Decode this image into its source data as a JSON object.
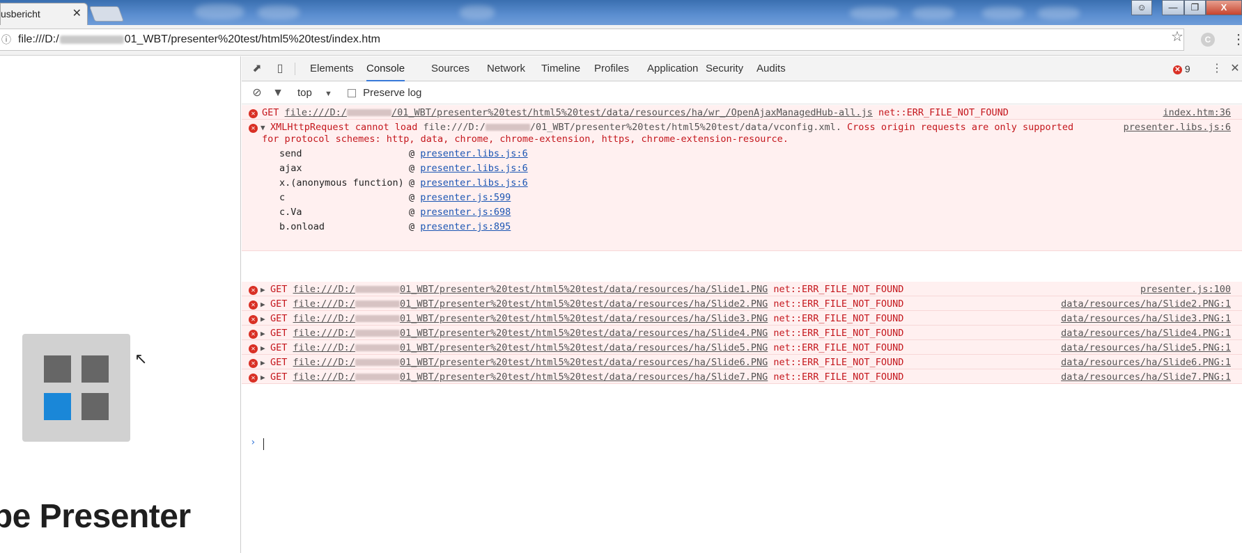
{
  "browser": {
    "tab_title": "usbericht",
    "tab_close": "✕",
    "window_controls": {
      "minimize": "—",
      "restore": "❐",
      "close": "X"
    },
    "url_prefix": "file:///D:/",
    "url_suffix": "01_WBT/presenter%20test/html5%20test/index.htm",
    "profile_initial": "C",
    "star_icon": "☆",
    "menu_icon": "⋮"
  },
  "page": {
    "title": "obe Presenter",
    "logo_colors": {
      "background": "#d1d1d1",
      "tile": "#666666",
      "accent": "#1a87d8"
    }
  },
  "devtools": {
    "tabs": [
      "Elements",
      "Console",
      "Sources",
      "Network",
      "Timeline",
      "Profiles",
      "Application",
      "Security",
      "Audits"
    ],
    "active_tab": "Console",
    "error_count": "9",
    "context": "top",
    "preserve_log_label": "Preserve log",
    "close_icon": "✕",
    "kebab_icon": "⋮"
  },
  "console": {
    "messages": [
      {
        "method": "GET",
        "url_prefix": "file:///D:/",
        "url_suffix": "/01_WBT/presenter%20test/html5%20test/data/resources/ha/wr_/OpenAjaxManagedHub-all.js",
        "error": "net::ERR_FILE_NOT_FOUND",
        "source": "index.htm:36"
      },
      {
        "method": "XMLHttpRequest cannot load",
        "url_prefix": "file:///D:/",
        "url_suffix": "/01_WBT/presenter%20test/html5%20test/data/vconfig.xml.",
        "error": "Cross origin requests are only supported",
        "error_line2": "for protocol schemes: http, data, chrome, chrome-extension, https, chrome-extension-resource.",
        "source": "presenter.libs.js:6",
        "stack": [
          {
            "fn": "send",
            "link": "presenter.libs.js:6"
          },
          {
            "fn": "ajax",
            "link": "presenter.libs.js:6"
          },
          {
            "fn": "x.(anonymous function)",
            "link": "presenter.libs.js:6"
          },
          {
            "fn": "c",
            "link": "presenter.js:599"
          },
          {
            "fn": "c.Va",
            "link": "presenter.js:698"
          },
          {
            "fn": "b.onload",
            "link": "presenter.js:895"
          }
        ]
      },
      {
        "method": "GET",
        "url_prefix": "file:///D:/",
        "url_suffix": "01_WBT/presenter%20test/html5%20test/data/resources/ha/Slide1.PNG",
        "error": "net::ERR_FILE_NOT_FOUND",
        "source": "presenter.js:100"
      },
      {
        "method": "GET",
        "url_prefix": "file:///D:/",
        "url_suffix": "01_WBT/presenter%20test/html5%20test/data/resources/ha/Slide2.PNG",
        "error": "net::ERR_FILE_NOT_FOUND",
        "source": "data/resources/ha/Slide2.PNG:1"
      },
      {
        "method": "GET",
        "url_prefix": "file:///D:/",
        "url_suffix": "01_WBT/presenter%20test/html5%20test/data/resources/ha/Slide3.PNG",
        "error": "net::ERR_FILE_NOT_FOUND",
        "source": "data/resources/ha/Slide3.PNG:1"
      },
      {
        "method": "GET",
        "url_prefix": "file:///D:/",
        "url_suffix": "01_WBT/presenter%20test/html5%20test/data/resources/ha/Slide4.PNG",
        "error": "net::ERR_FILE_NOT_FOUND",
        "source": "data/resources/ha/Slide4.PNG:1"
      },
      {
        "method": "GET",
        "url_prefix": "file:///D:/",
        "url_suffix": "01_WBT/presenter%20test/html5%20test/data/resources/ha/Slide5.PNG",
        "error": "net::ERR_FILE_NOT_FOUND",
        "source": "data/resources/ha/Slide5.PNG:1"
      },
      {
        "method": "GET",
        "url_prefix": "file:///D:/",
        "url_suffix": "01_WBT/presenter%20test/html5%20test/data/resources/ha/Slide6.PNG",
        "error": "net::ERR_FILE_NOT_FOUND",
        "source": "data/resources/ha/Slide6.PNG:1"
      },
      {
        "method": "GET",
        "url_prefix": "file:///D:/",
        "url_suffix": "01_WBT/presenter%20test/html5%20test/data/resources/ha/Slide7.PNG",
        "error": "net::ERR_FILE_NOT_FOUND",
        "source": "data/resources/ha/Slide7.PNG:1"
      }
    ],
    "prompt_caret": "›"
  }
}
